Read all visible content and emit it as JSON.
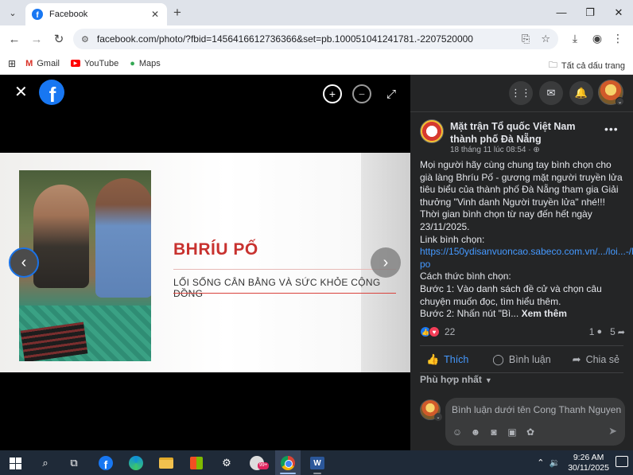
{
  "browser": {
    "tab_title": "Facebook",
    "url": "facebook.com/photo/?fbid=1456416612736366&set=pb.100051041241781.-2207520000",
    "bookmarks": [
      {
        "label": "Gmail"
      },
      {
        "label": "YouTube"
      },
      {
        "label": "Maps"
      }
    ],
    "all_bookmarks_label": "Tất cả dấu trang"
  },
  "photo": {
    "title": "BHRÍU PỐ",
    "subtitle": "LỐI SỐNG CÂN BẰNG VÀ SỨC KHỎE CỘNG ĐỒNG"
  },
  "post": {
    "author": "Mặt trận Tổ quốc Việt Nam thành phố Đà Nẵng",
    "meta": "18 tháng 11 lúc 08:54 · ",
    "paragraphs": [
      "Mọi người hãy cùng chung tay bình chọn cho già làng Bhríu Pố - gương mặt người truyền lửa tiêu biểu của thành phố Đà Nẵng tham gia Giải thưởng \"Vinh danh Người truyền lửa\" nhé!!! Thời gian bình chọn từ nay đến hết ngày 23/11/2025.",
      "Link bình chọn:",
      "Cách thức bình chọn:",
      "Bước 1: Vào danh sách đề cử và chọn câu chuyện muốn đọc, tìm hiểu thêm."
    ],
    "link": "https://150ydisanvuoncao.sabeco.com.vn/.../loi...-/bhriu-po",
    "last_line": "Bước 2: Nhấn nút \"Bì...",
    "see_more": "Xem thêm",
    "reaction_count": "22",
    "comment_count": "1",
    "share_count": "5",
    "actions": {
      "like": "Thích",
      "comment": "Bình luận",
      "share": "Chia sẻ"
    },
    "sort_label": "Phù hợp nhất",
    "comment_placeholder": "Bình luận dưới tên Cong Thanh Nguyen"
  },
  "taskbar": {
    "time": "9:26 AM",
    "date": "30/11/2025",
    "badge": "99+"
  },
  "colors": {
    "fb_blue": "#1877f2",
    "panel_bg": "#242526",
    "link": "#4599ff",
    "photo_title_red": "#c8322f"
  }
}
